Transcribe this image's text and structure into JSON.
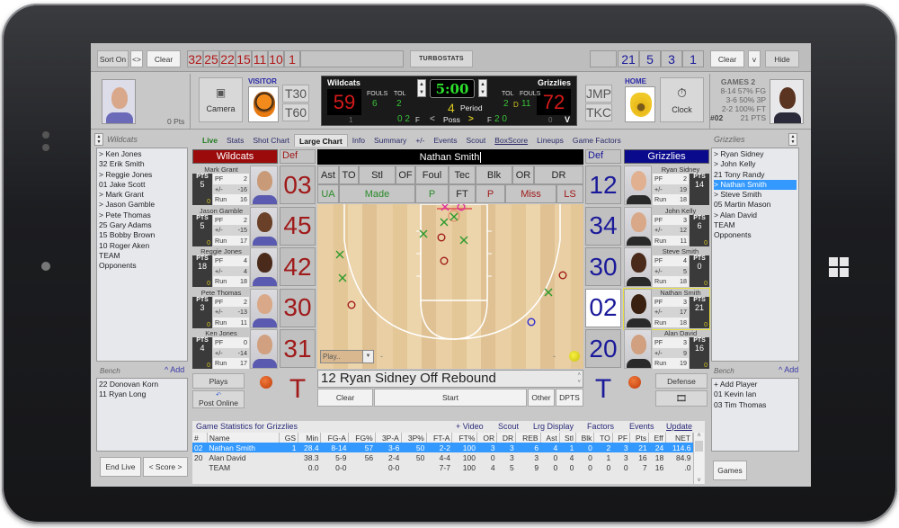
{
  "toolbar": {
    "sort_label": "Sort On",
    "swap_label": "<>",
    "clear_left_label": "Clear",
    "visitor_jerseys": [
      "32",
      "25",
      "22",
      "15",
      "11",
      "10",
      "1"
    ],
    "logo_text": "TURBOSTATS",
    "home_jerseys": [
      "21",
      "5",
      "3",
      "1"
    ],
    "clear_right_label": "Clear",
    "v_label": "v",
    "hide_label": "Hide"
  },
  "header": {
    "left_player_pts": "0 Pts",
    "camera_label": "Camera",
    "visitor_label": "VISITOR",
    "t30": "T30",
    "t60": "T60",
    "jmp": "JMP",
    "tkc": "TKC",
    "home_label": "HOME",
    "clock_label": "Clock",
    "games_title": "GAMES 2",
    "games_lines": [
      "8-14 57% FG",
      "3-6 50% 3P",
      "2-2 100% FT"
    ],
    "games_number": "#02",
    "games_pts": "21 PTS"
  },
  "scoreboard": {
    "visitor_name": "Wildcats",
    "home_name": "Grizzlies",
    "visitor_score": "59",
    "home_score": "72",
    "fouls_label": "FOULS",
    "tol_label": "TOL",
    "visitor_fouls": "6",
    "visitor_tol": "2",
    "home_tol": "2",
    "home_fouls": "11",
    "home_d": "D",
    "clock": "5:00",
    "period": "4",
    "period_label": "Period",
    "visitor_sub": "1",
    "home_sub": "0",
    "home_v": "V",
    "visitor_f": "0 2",
    "f_label": "F",
    "poss_label": "Poss",
    "home_f": "2 0"
  },
  "tabs": [
    {
      "label": "Live"
    },
    {
      "label": "Stats"
    },
    {
      "label": "Shot Chart"
    },
    {
      "label": "Large Chart"
    },
    {
      "label": "Info"
    },
    {
      "label": "Summary"
    },
    {
      "label": "+/-"
    },
    {
      "label": "Events"
    },
    {
      "label": "Scout"
    },
    {
      "label": "BoxScore"
    },
    {
      "label": "Lineups"
    },
    {
      "label": "Game Factors"
    }
  ],
  "visitor_roster": {
    "title": "Wildcats",
    "players": [
      "> Ken Jones",
      "32 Erik Smith",
      "> Reggie Jones",
      "01 Jake Scott",
      "> Mark Grant",
      "> Jason Gamble",
      "> Pete Thomas",
      "25 Gary Adams",
      "15 Bobby Brown",
      "10 Roger Aken",
      "TEAM",
      "Opponents"
    ],
    "bench_label": "Bench",
    "add_label": "^ Add",
    "bench": [
      "22 Donovan Korn",
      "11 Ryan Long"
    ]
  },
  "home_roster": {
    "title": "Grizzlies",
    "players": [
      "> Ryan Sidney",
      "> John Kelly",
      "21 Tony Randy",
      "> Nathan Smith",
      "> Steve Smith",
      "05 Martin Mason",
      "> Alan David",
      "TEAM",
      "Opponents"
    ],
    "selected_index": 3,
    "bench_label": "Bench",
    "add_label": "^ Add",
    "bench": [
      "+ Add Player",
      "01 Kevin Ian",
      "03 Tim Thomas"
    ]
  },
  "visitor_team_label": "Wildcats",
  "home_team_label": "Grizzlies",
  "def_label": "Def",
  "visitor_cards": [
    {
      "name": "Mark Grant",
      "pts": "5",
      "pf": "2",
      "pm": "-16",
      "run": "16",
      "zero": "0",
      "jersey": "03"
    },
    {
      "name": "Jason Gamble",
      "pts": "5",
      "pf": "2",
      "pm": "-15",
      "run": "17",
      "zero": "0",
      "jersey": "45"
    },
    {
      "name": "Reggie Jones",
      "pts": "18",
      "pf": "4",
      "pm": "4",
      "run": "18",
      "zero": "0",
      "jersey": "42"
    },
    {
      "name": "Pete Thomas",
      "pts": "3",
      "pf": "2",
      "pm": "-13",
      "run": "11",
      "zero": "0",
      "jersey": "30"
    },
    {
      "name": "Ken Jones",
      "pts": "4",
      "pf": "0",
      "pm": "-14",
      "run": "17",
      "zero": "0",
      "jersey": "31"
    }
  ],
  "home_cards": [
    {
      "name": "Ryan Sidney",
      "pts": "14",
      "pf": "2",
      "pm": "19",
      "run": "18",
      "zero": "",
      "jersey": "12"
    },
    {
      "name": "John Kelly",
      "pts": "6",
      "pf": "3",
      "pm": "12",
      "run": "11",
      "zero": "0",
      "jersey": "34"
    },
    {
      "name": "Steve Smith",
      "pts": "0",
      "pf": "4",
      "pm": "5",
      "run": "18",
      "zero": "0",
      "jersey": "30"
    },
    {
      "name": "Nathan Smith",
      "pts": "21",
      "pf": "3",
      "pm": "17",
      "run": "18",
      "zero": "0",
      "jersey": "02"
    },
    {
      "name": "Alan David",
      "pts": "16",
      "pf": "3",
      "pm": "9",
      "run": "19",
      "zero": "0",
      "jersey": "20"
    }
  ],
  "stat_labels": {
    "pts": "PTS",
    "pf": "PF",
    "pm": "+/-",
    "run": "Run"
  },
  "selected_player": "Nathan Smith",
  "actions_row1": [
    "Ast",
    "TO",
    "Stl",
    "OF",
    "Foul",
    "Tec",
    "Blk",
    "OR",
    "DR"
  ],
  "actions_row2": [
    "UA",
    "Made",
    "P",
    "FT",
    "P",
    "Miss",
    "LS"
  ],
  "court": {
    "play_select": "Play..",
    "dash_left": "-",
    "dash_right": "-"
  },
  "event_text": "12 Ryan Sidney  Off Rebound",
  "event_buttons": {
    "clear": "Clear",
    "start": "Start",
    "other": "Other",
    "dpts": "DPTS"
  },
  "t_label": "T",
  "plays_label": "Plays",
  "post_online_label": "Post Online",
  "defense_label": "Defense",
  "end_live_label": "End Live",
  "score_label": "< Score >",
  "games_label": "Games",
  "stats_panel": {
    "title": "Game Statistics for Grizzlies",
    "links": [
      "+ Video",
      "Scout",
      "Lrg Display",
      "Factors",
      "Events",
      "Update"
    ],
    "columns": [
      "#",
      "Name",
      "GS",
      "Min",
      "FG-A",
      "FG%",
      "3P-A",
      "3P%",
      "FT-A",
      "FT%",
      "OR",
      "DR",
      "REB",
      "Ast",
      "Stl",
      "Blk",
      "TO",
      "PF",
      "Pts",
      "Eff",
      "NET"
    ],
    "rows": [
      [
        "02",
        "Nathan Smith",
        "1",
        "28.4",
        "8-14",
        "57",
        "3-6",
        "50",
        "2-2",
        "100",
        "3",
        "3",
        "6",
        "4",
        "1",
        "0",
        "2",
        "3",
        "21",
        "24",
        "114.6"
      ],
      [
        "20",
        "Alan David",
        "",
        "38.3",
        "5-9",
        "56",
        "2-4",
        "50",
        "4-4",
        "100",
        "0",
        "3",
        "3",
        "0",
        "4",
        "0",
        "1",
        "3",
        "16",
        "18",
        "84.9"
      ],
      [
        "",
        "TEAM",
        "",
        "0.0",
        "0-0",
        "",
        "0-0",
        "",
        "7-7",
        "100",
        "4",
        "5",
        "9",
        "0",
        "0",
        "0",
        "0",
        "0",
        "7",
        "16",
        ".0"
      ]
    ],
    "selected_row": 0
  },
  "colors": {
    "visitor": "#9b0b0b",
    "home": "#0a0a8c",
    "selected": "#3399ff",
    "made": "#2a8a2a",
    "miss": "#a01a1a"
  }
}
